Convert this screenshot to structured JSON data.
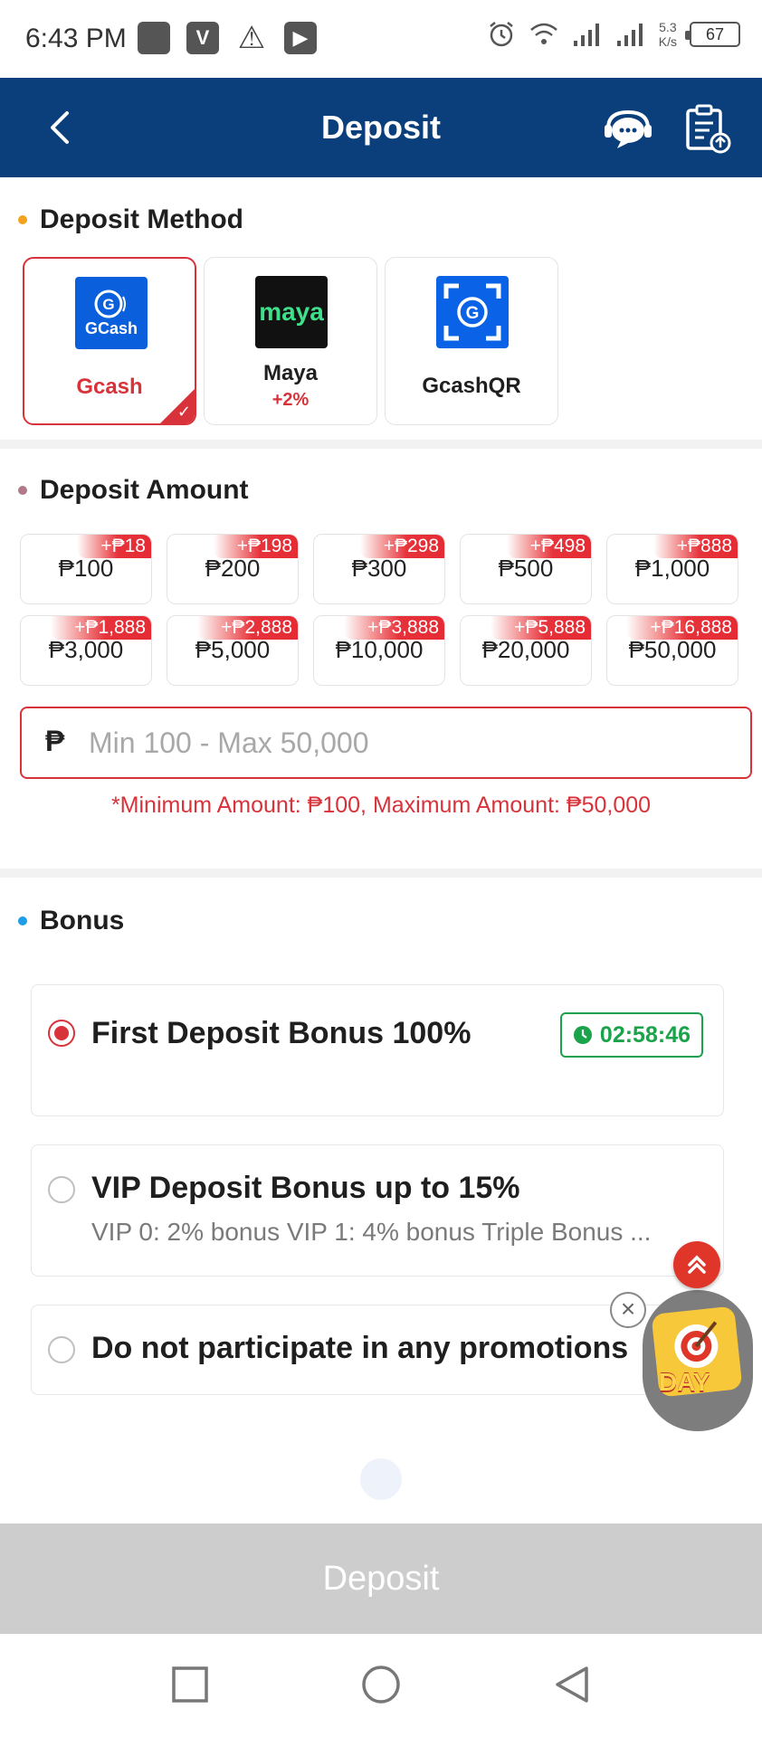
{
  "status_bar": {
    "time": "6:43 PM",
    "net_speed_value": "5.3",
    "net_speed_unit": "K/s",
    "battery": "67"
  },
  "header": {
    "title": "Deposit"
  },
  "deposit_method": {
    "section_title": "Deposit Method",
    "methods": [
      {
        "name": "Gcash",
        "logo_text": "GCash",
        "selected": true,
        "bonus": ""
      },
      {
        "name": "Maya",
        "logo_text": "maya",
        "selected": false,
        "bonus": "+2%"
      },
      {
        "name": "GcashQR",
        "logo_text": "",
        "selected": false,
        "bonus": ""
      }
    ]
  },
  "deposit_amount": {
    "section_title": "Deposit Amount",
    "options": [
      {
        "amount": "₱100",
        "bonus": "+₱18"
      },
      {
        "amount": "₱200",
        "bonus": "+₱198"
      },
      {
        "amount": "₱300",
        "bonus": "+₱298"
      },
      {
        "amount": "₱500",
        "bonus": "+₱498"
      },
      {
        "amount": "₱1,000",
        "bonus": "+₱888"
      },
      {
        "amount": "₱3,000",
        "bonus": "+₱1,888"
      },
      {
        "amount": "₱5,000",
        "bonus": "+₱2,888"
      },
      {
        "amount": "₱10,000",
        "bonus": "+₱3,888"
      },
      {
        "amount": "₱20,000",
        "bonus": "+₱5,888"
      },
      {
        "amount": "₱50,000",
        "bonus": "+₱16,888"
      }
    ],
    "currency_symbol": "₱",
    "input_value": "",
    "input_placeholder": "Min 100 - Max 50,000",
    "limit_note": "*Minimum Amount: ₱100, Maximum Amount: ₱50,000"
  },
  "bonus": {
    "section_title": "Bonus",
    "options": [
      {
        "title": "First Deposit Bonus 100%",
        "description": "",
        "selected": true,
        "timer": "02:58:46"
      },
      {
        "title": "VIP Deposit Bonus up to 15%",
        "description": "VIP 0: 2% bonus VIP 1: 4% bonus Triple Bonus ...",
        "selected": false,
        "timer": ""
      },
      {
        "title": "Do not participate in any promotions",
        "description": "",
        "selected": false,
        "timer": ""
      }
    ]
  },
  "floating_widget": {
    "label": "DAY"
  },
  "deposit_button": {
    "label": "Deposit"
  },
  "colors": {
    "header_bg": "#0b3f7c",
    "accent_red": "#d8323a",
    "timer_green": "#1aa34a",
    "method_dot": "#f2a21c",
    "amount_dot": "#b07a8a",
    "bonus_dot": "#1e9de8",
    "button_disabled": "#cdcdcd"
  }
}
